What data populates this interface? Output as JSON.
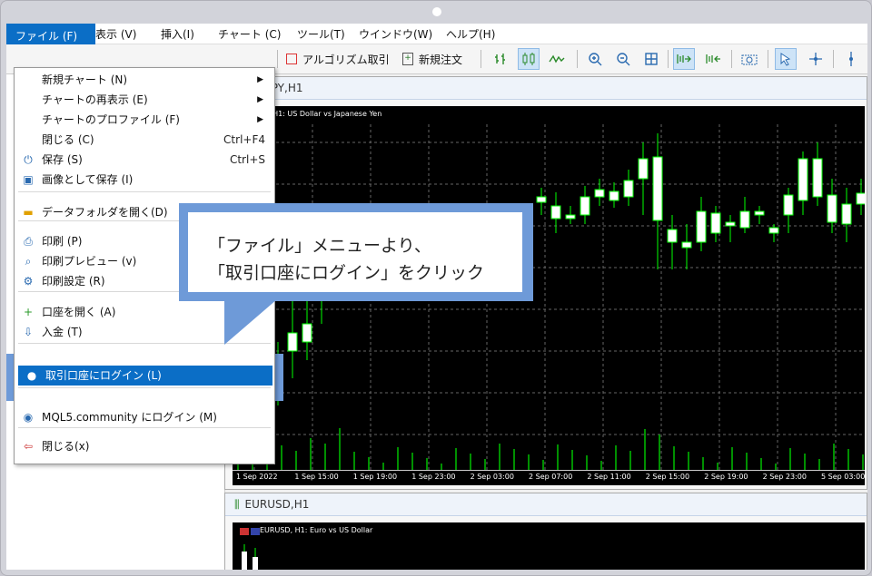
{
  "menubar": {
    "items": [
      "ファイル (F)",
      "表示 (V)",
      "挿入(I)",
      "チャート (C)",
      "ツール(T)",
      "ウインドウ(W)",
      "ヘルプ(H)"
    ]
  },
  "toolbar": {
    "algo_label": "アルゴリズム取引",
    "new_order_label": "新規注文"
  },
  "file_menu": {
    "items": [
      {
        "label": "新規チャート (N)",
        "shortcut": "",
        "submenu": true,
        "icon": ""
      },
      {
        "label": "チャートの再表示 (E)",
        "shortcut": "",
        "submenu": true,
        "icon": ""
      },
      {
        "label": "チャートのプロファイル (F)",
        "shortcut": "",
        "submenu": true,
        "icon": ""
      },
      {
        "label": "閉じる (C)",
        "shortcut": "Ctrl+F4",
        "submenu": false,
        "icon": ""
      },
      {
        "label": "保存 (S)",
        "shortcut": "Ctrl+S",
        "submenu": false,
        "icon": "save-icon"
      },
      {
        "label": "画像として保存 (I)",
        "shortcut": "",
        "submenu": false,
        "icon": "image-icon"
      },
      {
        "label": "データフォルダを開く(D)",
        "shortcut": "",
        "submenu": false,
        "icon": "folder-icon"
      },
      {
        "label": "印刷 (P)",
        "shortcut": "",
        "submenu": false,
        "icon": "print-icon"
      },
      {
        "label": "印刷プレビュー (v)",
        "shortcut": "",
        "submenu": false,
        "icon": "print-preview-icon"
      },
      {
        "label": "印刷設定 (R)",
        "shortcut": "",
        "submenu": false,
        "icon": "print-settings-icon"
      },
      {
        "label": "口座を開く (A)",
        "shortcut": "",
        "submenu": false,
        "icon": "plus-icon"
      },
      {
        "label": "入金 (T)",
        "shortcut": "",
        "submenu": false,
        "icon": "deposit-icon"
      },
      {
        "label": "取引口座にログイン (L)",
        "shortcut": "",
        "submenu": false,
        "icon": "user-icon"
      },
      {
        "label": "MQL5.community にログイン (M)",
        "shortcut": "",
        "submenu": false,
        "icon": "mql5-icon"
      },
      {
        "label": "閉じる(x)",
        "shortcut": "",
        "submenu": false,
        "icon": "exit-icon"
      }
    ]
  },
  "callout": {
    "line1": "「ファイル」メニューより、",
    "line2": "「取引口座にログイン」をクリック"
  },
  "chart1": {
    "tab_title": "USDJPY,H1",
    "label": "USDJPY, H1:  US Dollar vs Japanese Yen",
    "xlabels": [
      "1 Sep 2022",
      "1 Sep 15:00",
      "1 Sep 19:00",
      "1 Sep 23:00",
      "2 Sep 03:00",
      "2 Sep 07:00",
      "2 Sep 11:00",
      "2 Sep 15:00",
      "2 Sep 19:00",
      "2 Sep 23:00",
      "5 Sep 03:00"
    ]
  },
  "chart2": {
    "tab_title": "EURUSD,H1",
    "label": "EURUSD, H1:  Euro vs US Dollar"
  },
  "colors": {
    "accent": "#0b6ec6",
    "callout": "#6e9ad8",
    "candle_bull": "#ffffff",
    "candle_wick": "#00ff00",
    "chart_bg": "#000000"
  }
}
